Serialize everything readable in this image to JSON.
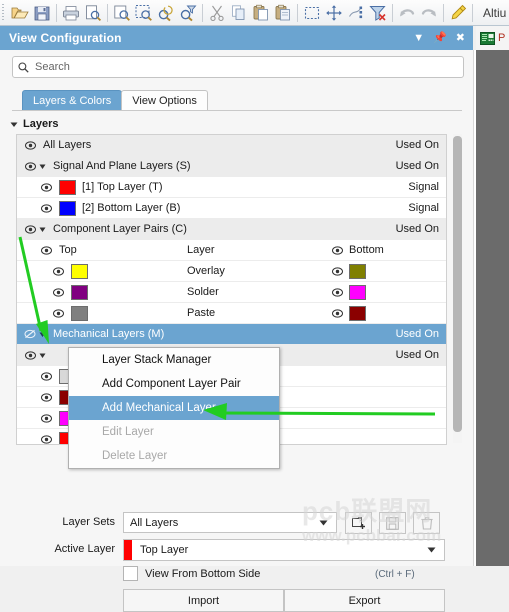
{
  "toolbar": {
    "icons": [
      "open-folder-icon",
      "save-icon",
      "print-icon",
      "print-preview-icon",
      "zoom-document-icon",
      "zoom-area-icon",
      "zoom-in-icon",
      "zoom-filter-icon",
      "cut-icon",
      "copy-icon",
      "paste-icon",
      "paste-special-icon",
      "select-area-icon",
      "move-icon",
      "align-icon",
      "clear-filter-icon",
      "undo-icon",
      "redo-icon",
      "highlighter-icon"
    ],
    "app_label": "Altiu"
  },
  "panel": {
    "title": "View Configuration",
    "controls": [
      "chevron-down-icon",
      "pin-icon",
      "close-icon"
    ],
    "doc_tab_label": "P"
  },
  "search": {
    "placeholder": "Search",
    "value": ""
  },
  "tabs": [
    {
      "label": "Layers & Colors",
      "active": true
    },
    {
      "label": "View Options",
      "active": false
    }
  ],
  "section": {
    "layers_caption": "Layers"
  },
  "list": {
    "rows": [
      {
        "name": "All Layers",
        "right": "Used On",
        "kind": "group",
        "indent": 0,
        "eye": "visible"
      },
      {
        "name": "Signal And Plane Layers (S)",
        "right": "Used On",
        "kind": "group",
        "indent": 0,
        "eye": "visible",
        "expander": true
      },
      {
        "name": "[1] Top Layer (T)",
        "right": "Signal",
        "kind": "layer",
        "indent": 1,
        "eye": "visible",
        "color": "#ff0000"
      },
      {
        "name": "[2] Bottom Layer (B)",
        "right": "Signal",
        "kind": "layer",
        "indent": 1,
        "eye": "visible",
        "color": "#0000ff"
      },
      {
        "name": "Component Layer Pairs (C)",
        "right": "Used On",
        "kind": "group",
        "indent": 0,
        "eye": "visible",
        "expander": true
      },
      {
        "name": "Top",
        "mid": "Layer",
        "bottom": "Bottom",
        "kind": "header",
        "indent": 1,
        "eye": "visible"
      },
      {
        "mid": "Overlay",
        "kind": "pair",
        "indent": 2,
        "eye": "visible",
        "color": "#ffff00",
        "bcolor": "#808000"
      },
      {
        "mid": "Solder",
        "kind": "pair",
        "indent": 2,
        "eye": "visible",
        "color": "#800080",
        "bcolor": "#ff00ff"
      },
      {
        "mid": "Paste",
        "kind": "pair",
        "indent": 2,
        "eye": "visible",
        "color": "#808080",
        "bcolor": "#8b0000"
      },
      {
        "name": "Mechanical Layers (M)",
        "right": "Used On",
        "kind": "group",
        "indent": 0,
        "eye": "hidden",
        "expander": true,
        "selected": true
      },
      {
        "name": "",
        "right": "Used On",
        "kind": "group",
        "indent": 0,
        "eye": "visible",
        "expander": true
      },
      {
        "name": "",
        "kind": "layer",
        "indent": 1,
        "eye": "visible",
        "color": "#d8d8d8"
      },
      {
        "name": "",
        "kind": "layer",
        "indent": 1,
        "eye": "visible",
        "color": "#8b0000"
      },
      {
        "name": "",
        "kind": "layer",
        "indent": 1,
        "eye": "visible",
        "color": "#ff00ff"
      },
      {
        "name": "",
        "kind": "layer",
        "indent": 1,
        "eye": "visible",
        "color": "#ff0000"
      }
    ]
  },
  "context_menu": {
    "items": [
      {
        "label": "Layer Stack Manager",
        "state": "normal"
      },
      {
        "label": "Add Component Layer Pair",
        "state": "normal"
      },
      {
        "label": "Add Mechanical Layer",
        "state": "highlighted"
      },
      {
        "label": "Edit Layer",
        "state": "disabled"
      },
      {
        "label": "Delete Layer",
        "state": "disabled"
      }
    ]
  },
  "footer": {
    "layer_sets_label": "Layer Sets",
    "layer_sets_value": "All Layers",
    "new_set_icon": "new-layer-set-icon",
    "save_set_icon": "save-icon",
    "delete_set_icon": "trash-icon",
    "active_layer_label": "Active Layer",
    "active_layer_value": "Top Layer",
    "active_layer_color": "#ff0000",
    "view_from_bottom_label": "View From Bottom Side",
    "view_from_bottom_checked": false,
    "shortcut_hint": "(Ctrl + F)",
    "import_label": "Import",
    "export_label": "Export"
  },
  "watermark": {
    "line1": "pcb联盟网",
    "line2": "www.pcbbar.com"
  },
  "colors": {
    "accent_blue": "#6ba4d0",
    "annotation_green": "#2ecc2e",
    "panel_bg": "#f6f6f6",
    "canvas_dark": "#6b6b6b"
  }
}
